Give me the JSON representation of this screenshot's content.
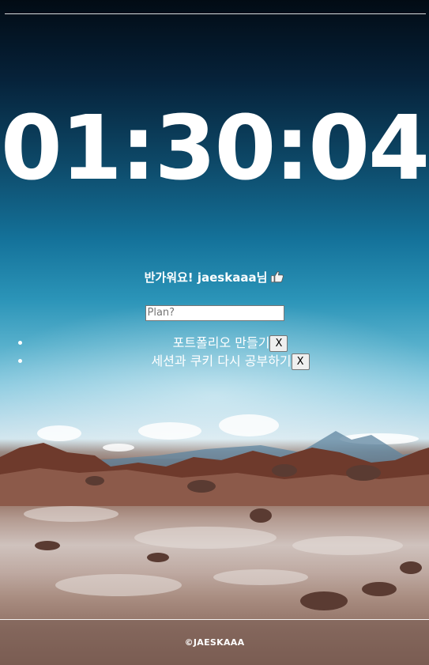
{
  "clock": {
    "time": "01:30:04"
  },
  "greeting": {
    "text": "반가워요! jaeskaaa님"
  },
  "plan_input": {
    "placeholder": "Plan?",
    "value": ""
  },
  "todos": [
    {
      "text": "포트폴리오 만들기",
      "delete_label": "X"
    },
    {
      "text": "세션과 쿠키 다시 공부하기",
      "delete_label": "X"
    }
  ],
  "footer": {
    "text": "©JAESKAAA"
  },
  "icons": {
    "greeting_icon": "thumbs-up-icon"
  },
  "colors": {
    "text": "#ffffff"
  }
}
